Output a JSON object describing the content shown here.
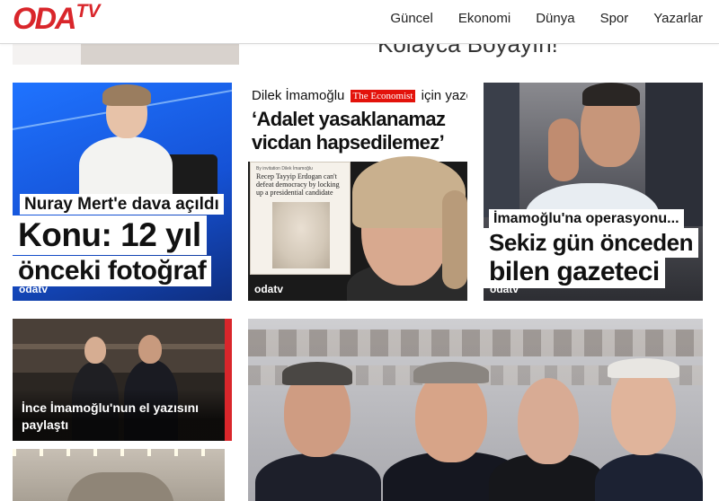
{
  "header": {
    "logo": "ODATV",
    "logo_main": "ODA",
    "logo_tv": "TV",
    "nav": [
      "Güncel",
      "Ekonomi",
      "Dünya",
      "Spor",
      "Yazarlar"
    ]
  },
  "top_strip": {
    "partial_title": "Kolayca Boyayın!"
  },
  "cards": [
    {
      "subtitle": "Nuray Mert'e dava açıldı",
      "line1": "Konu: 12 yıl",
      "line2": "önceki fotoğraf",
      "brand": "odatv"
    },
    {
      "top": "Dilek İmamoğlu",
      "econ_the": "The",
      "econ_name": "Economist",
      "top_suffix": "için yazdı:",
      "quote1": "‘Adalet yasaklanamaz",
      "quote2": "vicdan hapsedilemez’",
      "paper_byline": "By invitation Dilek İmamoğlu",
      "paper_text": "Recep Tayyip Erdogan can't defeat democracy by locking up a presidential candidate",
      "brand": "odatv"
    },
    {
      "subtitle": "İmamoğlu'na operasyonu...",
      "line1": "Sekiz gün önceden",
      "line2": "bilen gazeteci",
      "brand": "odatv"
    }
  ],
  "lower_left": {
    "title": "İnce İmamoğlu'nun el yazısını paylaştı"
  },
  "colors": {
    "brand_red": "#d9262b",
    "economist_red": "#e3120b",
    "text": "#222222"
  }
}
